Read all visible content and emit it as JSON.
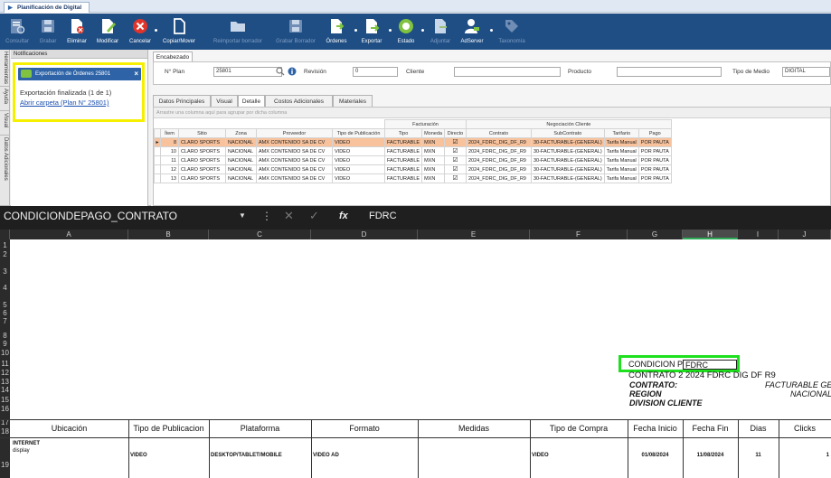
{
  "window": {
    "title": "Planificación de Digital"
  },
  "toolbar": {
    "buttons": [
      {
        "label": "Consultar",
        "enabled": false
      },
      {
        "label": "Grabar",
        "enabled": false
      },
      {
        "label": "Eliminar",
        "enabled": true
      },
      {
        "label": "Modificar",
        "enabled": true
      },
      {
        "label": "Cancelar",
        "enabled": true
      },
      {
        "label": "Copiar/Mover",
        "enabled": true
      },
      {
        "label": "Reimportar borrador",
        "enabled": false
      },
      {
        "label": "Grabar Borrador",
        "enabled": false
      },
      {
        "label": "Órdenes",
        "enabled": true
      },
      {
        "label": "Exportar",
        "enabled": true
      },
      {
        "label": "Estado",
        "enabled": true
      },
      {
        "label": "Adjuntar",
        "enabled": false
      },
      {
        "label": "AdServer",
        "enabled": true
      },
      {
        "label": "Taxonomía",
        "enabled": false
      }
    ]
  },
  "side_tabs": [
    "Herramientas",
    "Ayuda",
    "Visual",
    "Datos Adicionales"
  ],
  "notifications": {
    "header": "Notificaciones",
    "pill": "Exportación de Órdenes 25801",
    "close": "×",
    "message": "Exportación finalizada (1 de 1)",
    "link": "Abrir carpeta (Plan N° 25801)"
  },
  "header": {
    "tab": "Encabezado",
    "plan_label": "N° Plan",
    "plan_value": "25801",
    "revision_label": "Revisión",
    "revision_value": "0",
    "client_label": "Cliente",
    "product_label": "Producto",
    "media_label": "Tipo de Medio",
    "media_value": "DIGITAL"
  },
  "detail_tabs": [
    {
      "label": "Datos Principales",
      "active": false
    },
    {
      "label": "Visual",
      "active": false
    },
    {
      "label": "Detalle",
      "active": true
    },
    {
      "label": "Costos Adicionales",
      "active": false
    },
    {
      "label": "Materiales",
      "active": false
    }
  ],
  "grid": {
    "group_hint": "Arrastre una columna aquí para agrupar por dicha columna",
    "group_facturacion": "Facturación",
    "group_negociacion": "Negociación Cliente",
    "columns": [
      "Ítem",
      "Sitio",
      "Zona",
      "Proveedor",
      "Tipo de Publicación",
      "Tipo",
      "Moneda",
      "Directo",
      "Contrato",
      "SubContrato",
      "Tarifario",
      "Pago"
    ],
    "rows": [
      {
        "item": "8",
        "sitio": "CLARO SPORTS",
        "zona": "NACIONAL",
        "proveedor": "AMX CONTENIDO SA DE CV",
        "tipo_pub": "VIDEO",
        "tipo": "FACTURABLE",
        "moneda": "MXN",
        "contrato": "2024_FDRC_DIG_DF_R9",
        "subcontrato": "30-FACTURABLE-(GENERAL)",
        "tarifario": "Tarifa Manual",
        "pago": "POR PAUTA",
        "selected": true
      },
      {
        "item": "10",
        "sitio": "CLARO SPORTS",
        "zona": "NACIONAL",
        "proveedor": "AMX CONTENIDO SA DE CV",
        "tipo_pub": "VIDEO",
        "tipo": "FACTURABLE",
        "moneda": "MXN",
        "contrato": "2024_FDRC_DIG_DF_R9",
        "subcontrato": "30-FACTURABLE-(GENERAL)",
        "tarifario": "Tarifa Manual",
        "pago": "POR PAUTA",
        "selected": false
      },
      {
        "item": "11",
        "sitio": "CLARO SPORTS",
        "zona": "NACIONAL",
        "proveedor": "AMX CONTENIDO SA DE CV",
        "tipo_pub": "VIDEO",
        "tipo": "FACTURABLE",
        "moneda": "MXN",
        "contrato": "2024_FDRC_DIG_DF_R9",
        "subcontrato": "30-FACTURABLE-(GENERAL)",
        "tarifario": "Tarifa Manual",
        "pago": "POR PAUTA",
        "selected": false
      },
      {
        "item": "12",
        "sitio": "CLARO SPORTS",
        "zona": "NACIONAL",
        "proveedor": "AMX CONTENIDO SA DE CV",
        "tipo_pub": "VIDEO",
        "tipo": "FACTURABLE",
        "moneda": "MXN",
        "contrato": "2024_FDRC_DIG_DF_R9",
        "subcontrato": "30-FACTURABLE-(GENERAL)",
        "tarifario": "Tarifa Manual",
        "pago": "POR PAUTA",
        "selected": false
      },
      {
        "item": "13",
        "sitio": "CLARO SPORTS",
        "zona": "NACIONAL",
        "proveedor": "AMX CONTENIDO SA DE CV",
        "tipo_pub": "VIDEO",
        "tipo": "FACTURABLE",
        "moneda": "MXN",
        "contrato": "2024_FDRC_DIG_DF_R9",
        "subcontrato": "30-FACTURABLE-(GENERAL)",
        "tarifario": "Tarifa Manual",
        "pago": "POR PAUTA",
        "selected": false
      }
    ]
  },
  "excel": {
    "name_box": "CONDICIONDEPAGO_CONTRATO",
    "formula_value": "FDRC",
    "fx": "fx",
    "columns": [
      "A",
      "B",
      "C",
      "D",
      "E",
      "F",
      "G",
      "H",
      "I",
      "J"
    ],
    "selected_column": "H",
    "rows": [
      "1",
      "2",
      "3",
      "4",
      "5",
      "6",
      "7",
      "8",
      "9",
      "10",
      "11",
      "12",
      "13",
      "14",
      "15",
      "16",
      "17",
      "18",
      "19"
    ],
    "cells": {
      "cond_label": "CONDICION P",
      "cond_value": "FDRC",
      "contrato2": "CONTRATO 2  2024 FDRC DIG DF R9",
      "contrato_lbl": "CONTRATO:",
      "region_lbl": "REGION",
      "division_lbl": "DIVISION CLIENTE",
      "facturable": "FACTURABLE GEN",
      "nacional": "NACIONAL"
    },
    "table_headers": [
      "Ubicación",
      "Tipo de Publicacion",
      "Plataforma",
      "Formato",
      "Medidas",
      "Tipo de Compra",
      "Fecha Inicio",
      "Fecha Fin",
      "Dias",
      "Clicks"
    ],
    "table_row": {
      "ubicacion_1": "INTERNET",
      "ubicacion_2": "display",
      "tipo_pub": "VIDEO",
      "plataforma": "DESKTOP/TABLET/MOBILE",
      "formato": "VIDEO AD",
      "medidas": "",
      "tipo_compra": "VIDEO",
      "fecha_inicio": "01/08/2024",
      "fecha_fin": "11/08/2024",
      "dias": "11",
      "clicks": "1"
    }
  }
}
